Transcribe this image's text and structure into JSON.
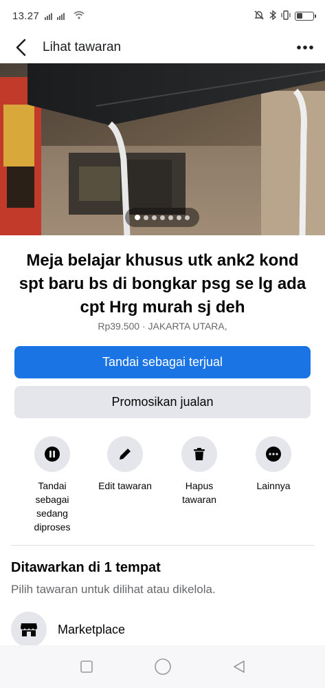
{
  "status_bar": {
    "time": "13.27",
    "battery_level": 0.35
  },
  "header": {
    "title": "Lihat tawaran",
    "back_icon": "chevron-left-icon",
    "more_icon": "more-horizontal-icon"
  },
  "photo": {
    "image_count": 7,
    "active_index": 0
  },
  "listing": {
    "title": "Meja belajar khusus utk ank2 kond spt baru bs di bongkar psg se lg ada cpt Hrg murah sj deh",
    "price_location": "Rp39.500 · JAKARTA UTARA,"
  },
  "buttons": {
    "mark_sold": "Tandai sebagai terjual",
    "promote": "Promosikan jualan"
  },
  "actions": [
    {
      "label": "Tandai sebagai sedang diproses",
      "icon": "pause-icon"
    },
    {
      "label": "Edit tawaran",
      "icon": "pencil-icon"
    },
    {
      "label": "Hapus tawaran",
      "icon": "trash-icon"
    },
    {
      "label": "Lainnya",
      "icon": "more-icon"
    }
  ],
  "section": {
    "title": "Ditawarkan di 1 tempat",
    "subtitle": "Pilih tawaran untuk dilihat atau dikelola."
  },
  "place": {
    "label": "Marketplace",
    "icon": "storefront-icon"
  },
  "nav_bar": {
    "icons": [
      "recents-square-icon",
      "home-circle-icon",
      "back-triangle-icon"
    ]
  },
  "colors": {
    "primary": "#1b74e4",
    "secondary_bg": "#e4e6eb",
    "muted_text": "#65676b"
  }
}
